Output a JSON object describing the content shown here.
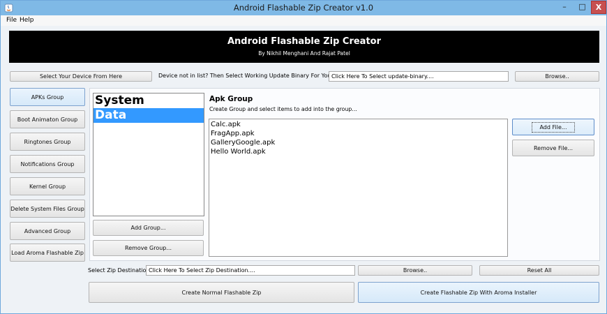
{
  "window": {
    "title": "Android Flashable Zip Creator v1.0",
    "minimize": "–",
    "maximize": "□",
    "close": "X"
  },
  "menu": {
    "file": "File",
    "help": "Help"
  },
  "banner": {
    "title": "Android Flashable Zip Creator",
    "subtitle": "By Nikhil Menghani And Rajat Patel"
  },
  "device": {
    "select_label": "Select Your Device From Here",
    "not_in_list_label": "Device not in list? Then Select Working Update Binary For Your Device :",
    "binary_field": "Click Here To Select update-binary....",
    "browse": "Browse.."
  },
  "sidebar": {
    "items": [
      {
        "label": "APKs Group"
      },
      {
        "label": "Boot Animaton Group"
      },
      {
        "label": "Ringtones Group"
      },
      {
        "label": "Notifications Group"
      },
      {
        "label": "Kernel Group"
      },
      {
        "label": "Delete System Files Group"
      },
      {
        "label": "Advanced Group"
      },
      {
        "label": "Load Aroma Flashable Zip"
      }
    ]
  },
  "groups": {
    "items": [
      {
        "label": "System"
      },
      {
        "label": "Data"
      }
    ],
    "add": "Add Group...",
    "remove": "Remove Group..."
  },
  "panel": {
    "title": "Apk Group",
    "description": "Create Group and select items to add into the group...",
    "files": [
      "Calc.apk",
      "FragApp.apk",
      "GalleryGoogle.apk",
      "Hello World.apk"
    ],
    "add_file": "Add File...",
    "remove_file": "Remove File..."
  },
  "destination": {
    "label": "Select Zip Destination :",
    "field": "Click Here To Select Zip Destination....",
    "browse": "Browse..",
    "reset": "Reset All"
  },
  "actions": {
    "normal": "Create Normal Flashable Zip",
    "aroma": "Create Flashable Zip With Aroma Installer"
  }
}
